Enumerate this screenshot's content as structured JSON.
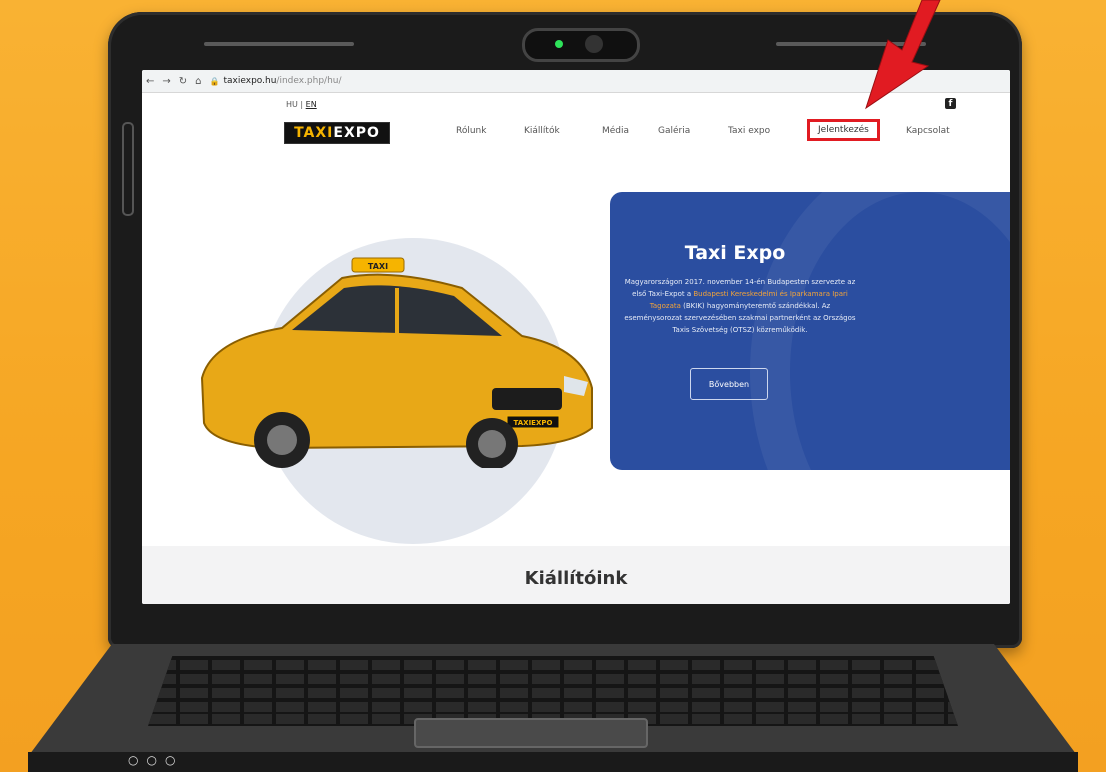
{
  "browser": {
    "url_host": "taxiexpo.hu",
    "url_path": "/index.php/hu/"
  },
  "site": {
    "lang": {
      "hu": "HU",
      "separator": "|",
      "en": "EN"
    },
    "logo": {
      "part1": "TAXI",
      "part2": "EXPO"
    },
    "menu": [
      "Rólunk",
      "Kiállítók",
      "Média",
      "Galéria",
      "Taxi expo",
      "Jelentkezés",
      "Kapcsolat"
    ],
    "highlighted_menu_item": "Jelentkezés",
    "facebook_icon": "f",
    "plate_text": "TAXIEXPO",
    "roof_sign_text": "TAXI"
  },
  "hero": {
    "title": "Taxi Expo",
    "text_1": "Magyarországon 2017. november 14-én Budapesten szervezte az első Taxi-Expot a ",
    "link": "Budapesti Kereskedelmi és Iparkamara Ipari Tagozata",
    "text_2": " (BKIK) hagyományteremtő szándékkal. Az eseménysorozat szervezésében szakmai partnerként az Országos Taxis Szövetség (OTSZ) közreműködik.",
    "button": "Bővebben"
  },
  "section": {
    "title": "Kiállítóink"
  },
  "colors": {
    "background": "#f6a623",
    "hero_blue": "#2b4ea0",
    "highlight_red": "#e11b22",
    "arrow_red": "#e11b22",
    "taxi_yellow": "#f6b400"
  }
}
